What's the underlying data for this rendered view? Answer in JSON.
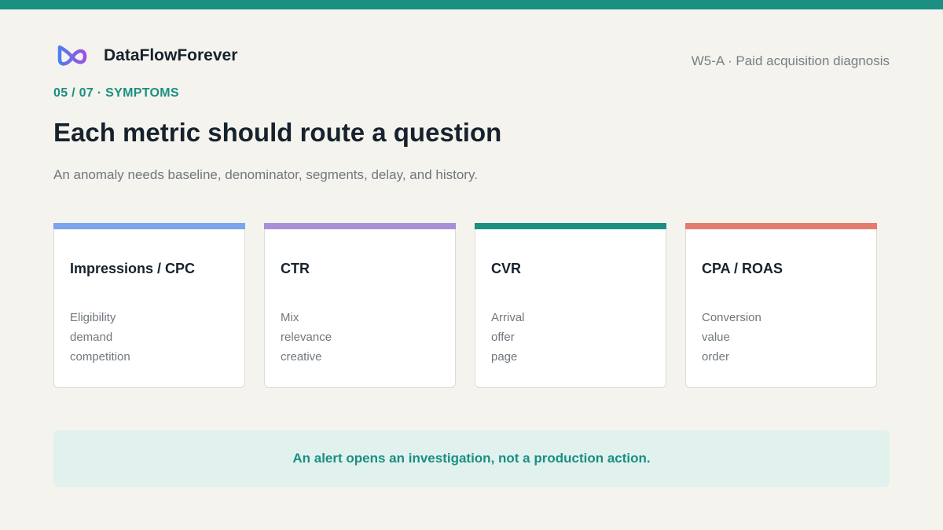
{
  "brand": {
    "name": "DataFlowForever",
    "logo_icon": "infinity-loop-icon",
    "logo_colors": [
      "#4f7df0",
      "#9a4fe0"
    ]
  },
  "session": "W5-A · Paid acquisition diagnosis",
  "kicker": "05 / 07 · SYMPTOMS",
  "title": "Each metric should route a question",
  "subtitle": "An anomaly needs baseline, denominator, segments, delay, and history.",
  "cards": [
    {
      "title": "Impressions / CPC",
      "accent": "#7ba4ec",
      "lines": [
        "Eligibility",
        "demand",
        "competition"
      ]
    },
    {
      "title": "CTR",
      "accent": "#a98fd8",
      "lines": [
        "Mix",
        "relevance",
        "creative"
      ]
    },
    {
      "title": "CVR",
      "accent": "#1a8f82",
      "lines": [
        "Arrival",
        "offer",
        "page"
      ]
    },
    {
      "title": "CPA / ROAS",
      "accent": "#e47b6e",
      "lines": [
        "Conversion",
        "value",
        "order"
      ]
    }
  ],
  "callout": "An alert opens an investigation, not a production action.",
  "colors": {
    "accent": "#1a8f82",
    "background": "#f4f3ee",
    "heading": "#17222d",
    "muted": "#70777d"
  }
}
